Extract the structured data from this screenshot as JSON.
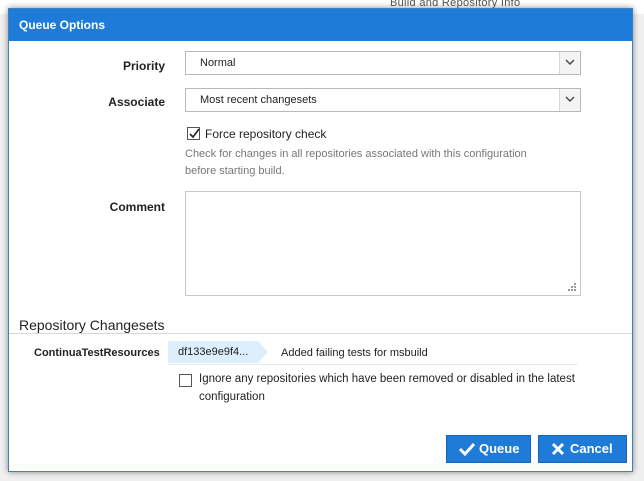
{
  "background": {
    "partial_text": "Build and Repository Info"
  },
  "dialog": {
    "title": "Queue Options"
  },
  "priority": {
    "label": "Priority",
    "selected": "Normal"
  },
  "associate": {
    "label": "Associate",
    "selected": "Most recent changesets"
  },
  "force_check": {
    "checked": true,
    "label": "Force repository check",
    "help_line1": "Check for changes in all repositories associated with this configuration",
    "help_line2": "before starting build."
  },
  "comment": {
    "label": "Comment",
    "value": ""
  },
  "repositories": {
    "title": "Repository Changesets",
    "rows": [
      {
        "name": "ContinuaTestResources",
        "changeset": "df133e9e9f4...",
        "message": "Added failing tests for msbuild"
      }
    ],
    "ignore_checked": false,
    "ignore_line1": "Ignore any repositories which have been removed or disabled in the latest",
    "ignore_line2": "configuration"
  },
  "buttons": {
    "queue": "Queue",
    "cancel": "Cancel"
  },
  "colors": {
    "accent": "#1f7bd8",
    "tag": "#ddeefc"
  },
  "icons": {
    "dropdown": "chevron-down-icon",
    "checked": "checkmark-icon",
    "resize": "resize-grip-icon",
    "queue": "checkmark-icon",
    "cancel": "close-icon"
  }
}
